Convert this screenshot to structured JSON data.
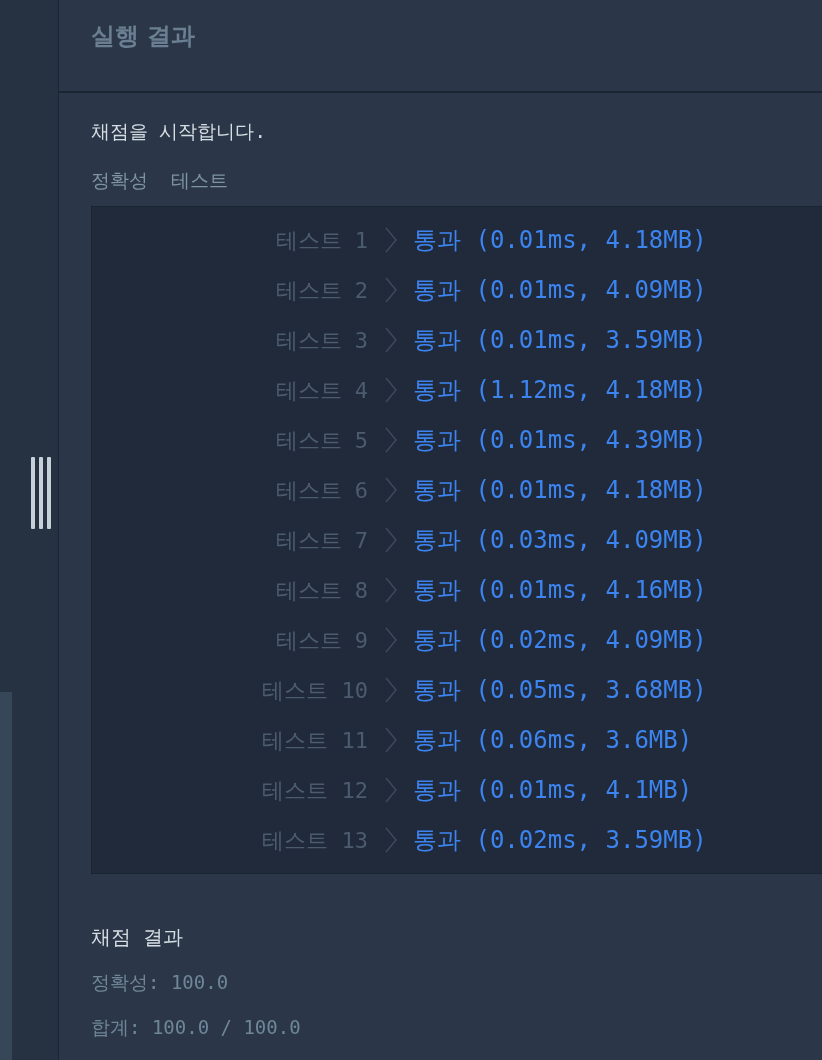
{
  "panel": {
    "title": "실행 결과"
  },
  "message": "채점을 시작합니다.",
  "section_title": "정확성  테스트",
  "tests": [
    {
      "label": "테스트 1",
      "result": "통과 (0.01ms, 4.18MB)"
    },
    {
      "label": "테스트 2",
      "result": "통과 (0.01ms, 4.09MB)"
    },
    {
      "label": "테스트 3",
      "result": "통과 (0.01ms, 3.59MB)"
    },
    {
      "label": "테스트 4",
      "result": "통과 (1.12ms, 4.18MB)"
    },
    {
      "label": "테스트 5",
      "result": "통과 (0.01ms, 4.39MB)"
    },
    {
      "label": "테스트 6",
      "result": "통과 (0.01ms, 4.18MB)"
    },
    {
      "label": "테스트 7",
      "result": "통과 (0.03ms, 4.09MB)"
    },
    {
      "label": "테스트 8",
      "result": "통과 (0.01ms, 4.16MB)"
    },
    {
      "label": "테스트 9",
      "result": "통과 (0.02ms, 4.09MB)"
    },
    {
      "label": "테스트 10",
      "result": "통과 (0.05ms, 3.68MB)"
    },
    {
      "label": "테스트 11",
      "result": "통과 (0.06ms, 3.6MB)"
    },
    {
      "label": "테스트 12",
      "result": "통과 (0.01ms, 4.1MB)"
    },
    {
      "label": "테스트 13",
      "result": "통과 (0.02ms, 3.59MB)"
    }
  ],
  "summary": {
    "title": "채점 결과",
    "lines": [
      "정확성: 100.0",
      "합계: 100.0 / 100.0"
    ]
  }
}
